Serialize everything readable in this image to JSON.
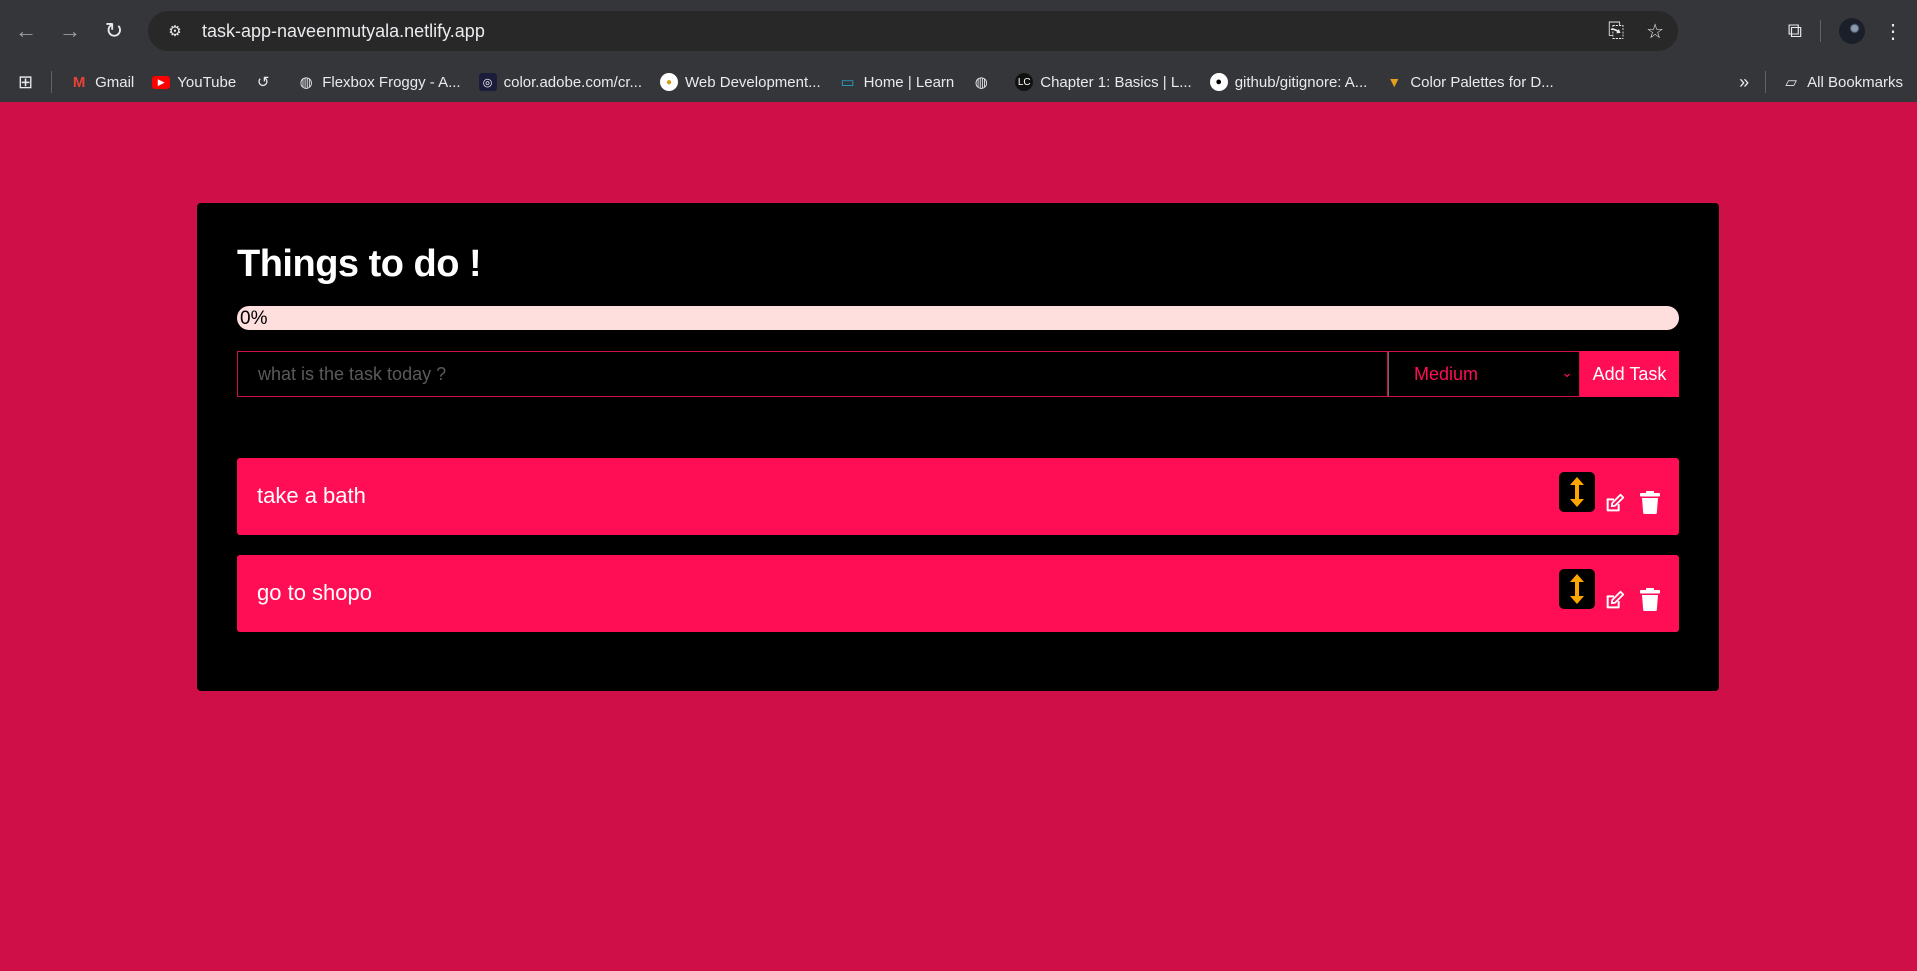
{
  "browser": {
    "url": "task-app-naveenmutyala.netlify.app",
    "bookmarks": [
      {
        "label": "Gmail"
      },
      {
        "label": "YouTube"
      },
      {
        "label": ""
      },
      {
        "label": "Flexbox Froggy - A..."
      },
      {
        "label": "color.adobe.com/cr..."
      },
      {
        "label": "Web Development..."
      },
      {
        "label": "Home | Learn"
      },
      {
        "label": ""
      },
      {
        "label": "Chapter 1: Basics | L..."
      },
      {
        "label": "github/gitignore: A..."
      },
      {
        "label": "Color Palettes for D..."
      }
    ],
    "all_bookmarks": "All Bookmarks"
  },
  "app": {
    "title": "Things to do !",
    "progress_label": "0%",
    "progress_fraction": 0,
    "input_placeholder": "what is the task today ?",
    "priority_selected": "Medium",
    "add_button": "Add Task",
    "tasks": [
      {
        "label": "take a bath"
      },
      {
        "label": "go to shopo"
      }
    ]
  },
  "colors": {
    "background": "#cf1048",
    "accent": "#ff0e55",
    "card": "#000000",
    "drag_icon": "#ffa500"
  },
  "icons": {
    "drag": "up-down-arrow-icon",
    "edit": "pencil-square-icon",
    "delete": "trash-icon"
  }
}
